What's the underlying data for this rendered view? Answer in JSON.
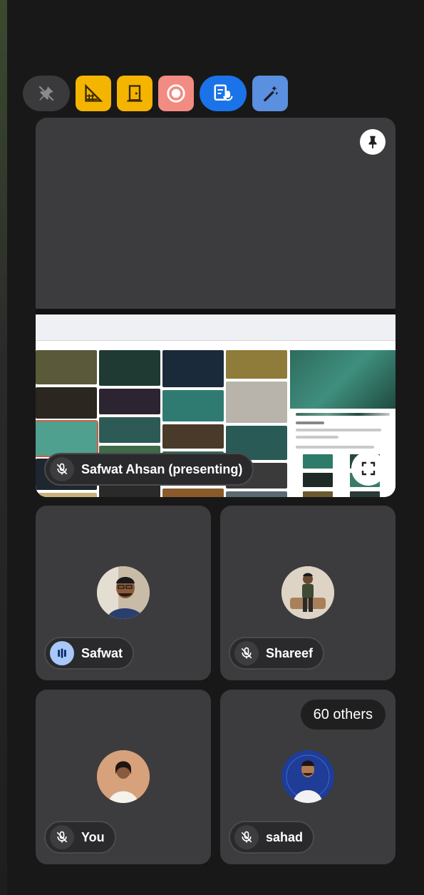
{
  "toolbar": {
    "items": [
      {
        "icon": "pin-off-icon",
        "color": "#3a3a3c"
      },
      {
        "icon": "ruler-grid-icon",
        "color": "#f4b400"
      },
      {
        "icon": "door-icon",
        "color": "#f4b400"
      },
      {
        "icon": "record-icon",
        "color": "#f28b82"
      },
      {
        "icon": "transcript-icon",
        "color": "#1a73e8"
      },
      {
        "icon": "magic-pen-icon",
        "color": "#5b8fe0"
      }
    ]
  },
  "presenting_tile": {
    "presenter_label": "Safwat Ahsan (presenting)",
    "pin_icon": "pin-icon",
    "fullscreen_icon": "fullscreen-icon"
  },
  "participants": [
    {
      "name": "Safwat",
      "mic": "speaking"
    },
    {
      "name": "Shareef",
      "mic": "muted"
    },
    {
      "name": "You",
      "mic": "muted"
    },
    {
      "name": "sahad",
      "mic": "muted",
      "badge": "60 others"
    }
  ],
  "colors": {
    "background": "#181818",
    "tile": "#3c3c3e",
    "speaking_indicator": "#a8c7fa"
  }
}
